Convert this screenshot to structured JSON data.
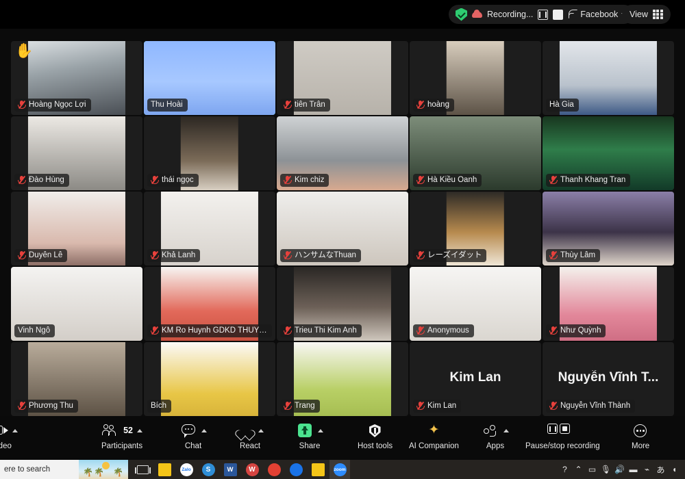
{
  "topbar": {
    "encryption_icon": "shield-green-icon",
    "recording_cloud_icon": "recording-cloud-icon",
    "recording_label": "Recording...",
    "pause_icon": "pause-icon",
    "stop_icon": "stop-icon",
    "stream_icon": "rss-stream-icon",
    "facebook_label": "Facebook",
    "facebook_caret": "chevron-down-icon",
    "view_label": "View",
    "view_icon": "grid-view-icon"
  },
  "grid": {
    "active_speaker": "Thu Hoài",
    "active_border_color": "#35d07f",
    "tiles": [
      {
        "name": "Hoàng Ngọc Lợi",
        "muted": true,
        "video": true,
        "hand_raised": true,
        "fill": "f1",
        "size": "mid"
      },
      {
        "name": "Thu Hoài",
        "muted": false,
        "video": true,
        "hand_raised": false,
        "fill": "f2",
        "size": "wide",
        "active": true
      },
      {
        "name": "tiên Trân",
        "muted": true,
        "video": true,
        "hand_raised": false,
        "fill": "f3",
        "size": "mid"
      },
      {
        "name": "hoàng",
        "muted": true,
        "video": true,
        "hand_raised": false,
        "fill": "f4",
        "size": "narrow"
      },
      {
        "name": "Hà Gia",
        "muted": false,
        "video": true,
        "hand_raised": false,
        "fill": "f5",
        "size": "mid"
      },
      {
        "name": "Đào Hùng",
        "muted": true,
        "video": true,
        "hand_raised": false,
        "fill": "f6",
        "size": "mid"
      },
      {
        "name": "thái ngọc",
        "muted": true,
        "video": true,
        "hand_raised": false,
        "fill": "f7",
        "size": "narrow"
      },
      {
        "name": "Kim chiz",
        "muted": true,
        "video": true,
        "hand_raised": false,
        "fill": "f8",
        "size": "wide"
      },
      {
        "name": "Hà Kiều Oanh",
        "muted": true,
        "video": true,
        "hand_raised": false,
        "fill": "f9",
        "size": "wide"
      },
      {
        "name": "Thanh Khang Tran",
        "muted": true,
        "video": true,
        "hand_raised": false,
        "fill": "f10",
        "size": "wide"
      },
      {
        "name": "Duyên Lê",
        "muted": true,
        "video": true,
        "hand_raised": false,
        "fill": "f11",
        "size": "mid"
      },
      {
        "name": "Khả Lanh",
        "muted": true,
        "video": true,
        "hand_raised": false,
        "fill": "f12",
        "size": "mid"
      },
      {
        "name": "ハンサムなThuan",
        "muted": true,
        "video": true,
        "hand_raised": false,
        "fill": "f13",
        "size": "wide"
      },
      {
        "name": "レーズイダット",
        "muted": true,
        "video": true,
        "hand_raised": false,
        "fill": "f14",
        "size": "narrow"
      },
      {
        "name": "Thùy Lâm",
        "muted": true,
        "video": true,
        "hand_raised": false,
        "fill": "f15",
        "size": "wide"
      },
      {
        "name": "Vinh Ngô",
        "muted": false,
        "video": true,
        "hand_raised": false,
        "fill": "f16",
        "size": "wide"
      },
      {
        "name": "KM Ro Huynh GDKD THUY D...",
        "muted": true,
        "video": true,
        "hand_raised": false,
        "fill": "f17",
        "size": "mid"
      },
      {
        "name": "Trieu Thi Kim Anh",
        "muted": true,
        "video": true,
        "hand_raised": false,
        "fill": "f18",
        "size": "mid"
      },
      {
        "name": "Anonymous",
        "muted": true,
        "video": true,
        "hand_raised": false,
        "fill": "f19",
        "size": "wide"
      },
      {
        "name": "Như Quỳnh",
        "muted": true,
        "video": true,
        "hand_raised": false,
        "fill": "f20",
        "size": "mid"
      },
      {
        "name": "Phương Thu",
        "muted": true,
        "video": true,
        "hand_raised": false,
        "fill": "f21",
        "size": "mid"
      },
      {
        "name": "Bích",
        "muted": false,
        "video": true,
        "hand_raised": false,
        "fill": "f22",
        "size": "mid"
      },
      {
        "name": "Trang",
        "muted": true,
        "video": true,
        "hand_raised": false,
        "fill": "f23",
        "size": "mid"
      },
      {
        "name": "Kim Lan",
        "muted": true,
        "video": false,
        "hand_raised": false,
        "big_name": "Kim Lan"
      },
      {
        "name": "Nguyễn Vĩnh Thành",
        "muted": true,
        "video": false,
        "hand_raised": false,
        "big_name": "Nguyễn Vĩnh T..."
      }
    ]
  },
  "toolbar": {
    "video_label": "ideo",
    "participants_label": "Participants",
    "participants_count": "52",
    "chat_label": "Chat",
    "react_label": "React",
    "share_label": "Share",
    "host_tools_label": "Host tools",
    "ai_companion_label": "AI Companion",
    "ai_companion_glyph": "✦",
    "apps_label": "Apps",
    "recording_label": "Pause/stop recording",
    "more_label": "More"
  },
  "taskbar": {
    "search_placeholder": "ere to search",
    "apps": [
      {
        "name": "task-view-icon",
        "glyph": "",
        "color": ""
      },
      {
        "name": "sticky-notes-icon",
        "glyph": "",
        "color": "#f5c518"
      },
      {
        "name": "zalo-icon",
        "glyph": "Zalo",
        "color": "#ffffff"
      },
      {
        "name": "s-app-icon",
        "glyph": "S",
        "color": "#2f8ed6"
      },
      {
        "name": "word-icon",
        "glyph": "W",
        "color": "#2b579a"
      },
      {
        "name": "wps-icon",
        "glyph": "W",
        "color": "#d64541"
      },
      {
        "name": "chrome-icon",
        "glyph": "",
        "color": "#e34133"
      },
      {
        "name": "chrome-beta-icon",
        "glyph": "",
        "color": "#1a73e8"
      },
      {
        "name": "file-explorer-icon",
        "glyph": "",
        "color": "#f5c518"
      },
      {
        "name": "zoom-icon",
        "glyph": "zoom",
        "color": "#2d8cff"
      }
    ],
    "tray": [
      {
        "name": "help-icon",
        "glyph": "?"
      },
      {
        "name": "chevron-up-icon",
        "glyph": "⌃"
      },
      {
        "name": "camera-icon",
        "glyph": "▭"
      },
      {
        "name": "microphone-icon",
        "glyph": "🎙"
      },
      {
        "name": "volume-icon",
        "glyph": "🔊"
      },
      {
        "name": "battery-icon",
        "glyph": "▬"
      },
      {
        "name": "wifi-icon",
        "glyph": "⌁"
      },
      {
        "name": "ime-icon",
        "glyph": "あ"
      },
      {
        "name": "notifications-icon",
        "glyph": "◖"
      }
    ]
  }
}
